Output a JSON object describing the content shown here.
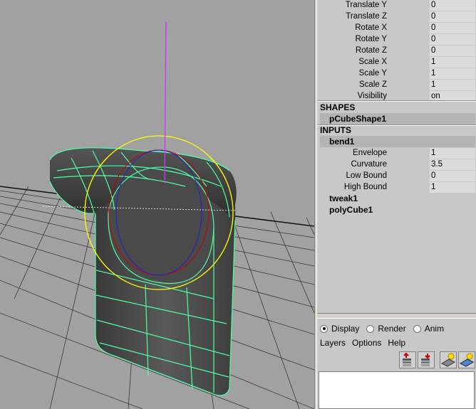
{
  "channel_box": {
    "attributes": [
      {
        "label": "Translate Y",
        "value": "0"
      },
      {
        "label": "Translate Z",
        "value": "0"
      },
      {
        "label": "Rotate X",
        "value": "0"
      },
      {
        "label": "Rotate Y",
        "value": "0"
      },
      {
        "label": "Rotate Z",
        "value": "0"
      },
      {
        "label": "Scale X",
        "value": "1"
      },
      {
        "label": "Scale Y",
        "value": "1"
      },
      {
        "label": "Scale Z",
        "value": "1"
      },
      {
        "label": "Visibility",
        "value": "on"
      }
    ],
    "shapes_header": "SHAPES",
    "shape_node": "pCubeShape1",
    "inputs_header": "INPUTS",
    "input_node": "bend1",
    "bend_attributes": [
      {
        "label": "Envelope",
        "value": "1"
      },
      {
        "label": "Curvature",
        "value": "3.5"
      },
      {
        "label": "Low Bound",
        "value": "0"
      },
      {
        "label": "High Bound",
        "value": "1"
      }
    ],
    "other_inputs": [
      "tweak1",
      "polyCube1"
    ]
  },
  "layer_editor": {
    "modes": [
      {
        "label": "Display",
        "selected": true
      },
      {
        "label": "Render",
        "selected": false
      },
      {
        "label": "Anim",
        "selected": false
      }
    ],
    "menu": [
      "Layers",
      "Options",
      "Help"
    ],
    "tool_icons": [
      "new-layer-icon",
      "new-layer-from-selected-icon",
      "new-render-layer-icon",
      "new-anim-layer-icon"
    ]
  },
  "colors": {
    "viewport_bg": "#a1a1a1",
    "panel_bg": "#c8c8c8",
    "wireframe": "#4dffa6",
    "bend_handle": "#ffff00",
    "pivot_axis": "#cc33ff"
  }
}
